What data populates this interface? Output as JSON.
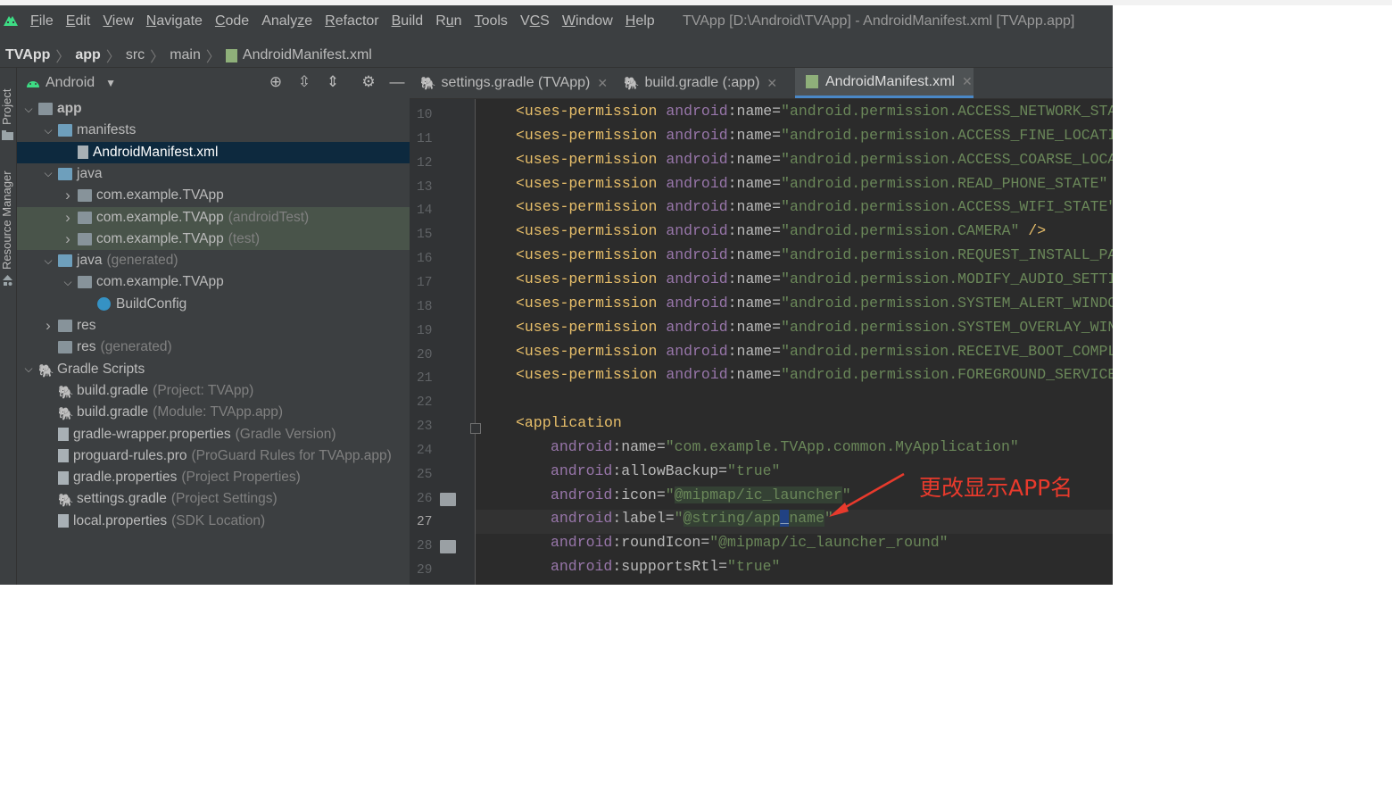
{
  "window": {
    "title": "TVApp [D:\\Android\\TVApp] - AndroidManifest.xml [TVApp.app]",
    "menu": [
      {
        "label": "File",
        "mnemonic_index": 0
      },
      {
        "label": "Edit",
        "mnemonic_index": 0
      },
      {
        "label": "View",
        "mnemonic_index": 0
      },
      {
        "label": "Navigate",
        "mnemonic_index": 0
      },
      {
        "label": "Code",
        "mnemonic_index": 0
      },
      {
        "label": "Analyze",
        "mnemonic_index": 5
      },
      {
        "label": "Refactor",
        "mnemonic_index": 0
      },
      {
        "label": "Build",
        "mnemonic_index": 0
      },
      {
        "label": "Run",
        "mnemonic_index": 1
      },
      {
        "label": "Tools",
        "mnemonic_index": 0
      },
      {
        "label": "VCS",
        "mnemonic_index": 1
      },
      {
        "label": "Window",
        "mnemonic_index": 0
      },
      {
        "label": "Help",
        "mnemonic_index": 0
      }
    ]
  },
  "breadcrumb": [
    "TVApp",
    "app",
    "src",
    "main",
    "AndroidManifest.xml"
  ],
  "left_strip": {
    "project": "Project",
    "resource_manager": "Resource Manager"
  },
  "project_panel": {
    "view_label": "Android",
    "tree": [
      {
        "label": "app",
        "hint": "",
        "depth": 0,
        "expand": "open",
        "icon": "module-folder",
        "bold": true
      },
      {
        "label": "manifests",
        "hint": "",
        "depth": 1,
        "expand": "open",
        "icon": "folder-blue"
      },
      {
        "label": "AndroidManifest.xml",
        "hint": "",
        "depth": 2,
        "expand": "none",
        "icon": "manifest-file",
        "selected": true
      },
      {
        "label": "java",
        "hint": "",
        "depth": 1,
        "expand": "open",
        "icon": "folder-blue"
      },
      {
        "label": "com.example.TVApp",
        "hint": "",
        "depth": 2,
        "expand": "closed",
        "icon": "package"
      },
      {
        "label": "com.example.TVApp",
        "hint": "(androidTest)",
        "depth": 2,
        "expand": "closed",
        "icon": "package",
        "test": true
      },
      {
        "label": "com.example.TVApp",
        "hint": "(test)",
        "depth": 2,
        "expand": "closed",
        "icon": "package",
        "test": true
      },
      {
        "label": "java",
        "hint": "(generated)",
        "depth": 1,
        "expand": "open",
        "icon": "folder-generated"
      },
      {
        "label": "com.example.TVApp",
        "hint": "",
        "depth": 2,
        "expand": "open",
        "icon": "package"
      },
      {
        "label": "BuildConfig",
        "hint": "",
        "depth": 3,
        "expand": "none",
        "icon": "class"
      },
      {
        "label": "res",
        "hint": "",
        "depth": 1,
        "expand": "closed",
        "icon": "folder-res"
      },
      {
        "label": "res",
        "hint": "(generated)",
        "depth": 1,
        "expand": "none",
        "icon": "folder-res"
      },
      {
        "label": "Gradle Scripts",
        "hint": "",
        "depth": 0,
        "expand": "open",
        "icon": "gradle"
      },
      {
        "label": "build.gradle",
        "hint": "(Project: TVApp)",
        "depth": 1,
        "expand": "none",
        "icon": "gradle"
      },
      {
        "label": "build.gradle",
        "hint": "(Module: TVApp.app)",
        "depth": 1,
        "expand": "none",
        "icon": "gradle"
      },
      {
        "label": "gradle-wrapper.properties",
        "hint": "(Gradle Version)",
        "depth": 1,
        "expand": "none",
        "icon": "properties"
      },
      {
        "label": "proguard-rules.pro",
        "hint": "(ProGuard Rules for TVApp.app)",
        "depth": 1,
        "expand": "none",
        "icon": "text-file"
      },
      {
        "label": "gradle.properties",
        "hint": "(Project Properties)",
        "depth": 1,
        "expand": "none",
        "icon": "properties"
      },
      {
        "label": "settings.gradle",
        "hint": "(Project Settings)",
        "depth": 1,
        "expand": "none",
        "icon": "gradle"
      },
      {
        "label": "local.properties",
        "hint": "(SDK Location)",
        "depth": 1,
        "expand": "none",
        "icon": "properties"
      }
    ]
  },
  "tabs": [
    {
      "label": "settings.gradle (TVApp)",
      "icon": "gradle-icon",
      "active": false
    },
    {
      "label": "build.gradle (:app)",
      "icon": "gradle-icon",
      "active": false
    },
    {
      "label": "AndroidManifest.xml",
      "icon": "manifest-icon",
      "active": true
    }
  ],
  "editor": {
    "current_line": 27,
    "lines": [
      {
        "no": 10,
        "indent": 1,
        "tokens": [
          [
            "t",
            "<uses-permission "
          ],
          [
            "a",
            "android"
          ],
          [
            "n",
            ":name="
          ],
          [
            "v",
            "\"android.permission.ACCESS_NETWORK_STATE\""
          ]
        ]
      },
      {
        "no": 11,
        "indent": 1,
        "tokens": [
          [
            "t",
            "<uses-permission "
          ],
          [
            "a",
            "android"
          ],
          [
            "n",
            ":name="
          ],
          [
            "v",
            "\"android.permission.ACCESS_FINE_LOCATION\""
          ]
        ]
      },
      {
        "no": 12,
        "indent": 1,
        "tokens": [
          [
            "t",
            "<uses-permission "
          ],
          [
            "a",
            "android"
          ],
          [
            "n",
            ":name="
          ],
          [
            "v",
            "\"android.permission.ACCESS_COARSE_LOCATION\""
          ]
        ]
      },
      {
        "no": 13,
        "indent": 1,
        "tokens": [
          [
            "t",
            "<uses-permission "
          ],
          [
            "a",
            "android"
          ],
          [
            "n",
            ":name="
          ],
          [
            "v",
            "\"android.permission.READ_PHONE_STATE\""
          ],
          [
            "t",
            " />"
          ]
        ]
      },
      {
        "no": 14,
        "indent": 1,
        "tokens": [
          [
            "t",
            "<uses-permission "
          ],
          [
            "a",
            "android"
          ],
          [
            "n",
            ":name="
          ],
          [
            "v",
            "\"android.permission.ACCESS_WIFI_STATE\""
          ],
          [
            "t",
            " />"
          ]
        ]
      },
      {
        "no": 15,
        "indent": 1,
        "tokens": [
          [
            "t",
            "<uses-permission "
          ],
          [
            "a",
            "android"
          ],
          [
            "n",
            ":name="
          ],
          [
            "v",
            "\"android.permission.CAMERA\""
          ],
          [
            "t",
            " />"
          ]
        ]
      },
      {
        "no": 16,
        "indent": 1,
        "tokens": [
          [
            "t",
            "<uses-permission "
          ],
          [
            "a",
            "android"
          ],
          [
            "n",
            ":name="
          ],
          [
            "v",
            "\"android.permission.REQUEST_INSTALL_PACKAGES\""
          ]
        ]
      },
      {
        "no": 17,
        "indent": 1,
        "tokens": [
          [
            "t",
            "<uses-permission "
          ],
          [
            "a",
            "android"
          ],
          [
            "n",
            ":name="
          ],
          [
            "v",
            "\"android.permission.MODIFY_AUDIO_SETTINGS\""
          ]
        ]
      },
      {
        "no": 18,
        "indent": 1,
        "tokens": [
          [
            "t",
            "<uses-permission "
          ],
          [
            "a",
            "android"
          ],
          [
            "n",
            ":name="
          ],
          [
            "v",
            "\"android.permission.SYSTEM_ALERT_WINDOW\""
          ]
        ]
      },
      {
        "no": 19,
        "indent": 1,
        "tokens": [
          [
            "t",
            "<uses-permission "
          ],
          [
            "a",
            "android"
          ],
          [
            "n",
            ":name="
          ],
          [
            "v",
            "\"android.permission.SYSTEM_OVERLAY_WINDOW\""
          ]
        ]
      },
      {
        "no": 20,
        "indent": 1,
        "tokens": [
          [
            "t",
            "<uses-permission "
          ],
          [
            "a",
            "android"
          ],
          [
            "n",
            ":name="
          ],
          [
            "v",
            "\"android.permission.RECEIVE_BOOT_COMPLETED\""
          ]
        ]
      },
      {
        "no": 21,
        "indent": 1,
        "tokens": [
          [
            "t",
            "<uses-permission "
          ],
          [
            "a",
            "android"
          ],
          [
            "n",
            ":name="
          ],
          [
            "v",
            "\"android.permission.FOREGROUND_SERVICE\""
          ]
        ]
      },
      {
        "no": 22,
        "indent": 0,
        "tokens": []
      },
      {
        "no": 23,
        "indent": 1,
        "tokens": [
          [
            "t",
            "<application"
          ]
        ],
        "fold": true
      },
      {
        "no": 24,
        "indent": 2,
        "tokens": [
          [
            "a",
            "android"
          ],
          [
            "n",
            ":name="
          ],
          [
            "v",
            "\"com.example.TVApp.common.MyApplication\""
          ]
        ]
      },
      {
        "no": 25,
        "indent": 2,
        "tokens": [
          [
            "a",
            "android"
          ],
          [
            "n",
            ":allowBackup="
          ],
          [
            "v",
            "\"true\""
          ]
        ]
      },
      {
        "no": 26,
        "indent": 2,
        "tokens": [
          [
            "a",
            "android"
          ],
          [
            "n",
            ":icon="
          ],
          [
            "v",
            "\""
          ],
          [
            "hl",
            "@mipmap/ic_launcher"
          ],
          [
            "v",
            "\""
          ]
        ],
        "gutter_image": true
      },
      {
        "no": 27,
        "indent": 2,
        "tokens": [
          [
            "a",
            "android"
          ],
          [
            "n",
            ":label="
          ],
          [
            "v",
            "\""
          ],
          [
            "hl",
            "@string/app"
          ],
          [
            "caret",
            "_"
          ],
          [
            "hl",
            "name"
          ],
          [
            "v",
            "\""
          ]
        ]
      },
      {
        "no": 28,
        "indent": 2,
        "tokens": [
          [
            "a",
            "android"
          ],
          [
            "n",
            ":roundIcon="
          ],
          [
            "v",
            "\"@mipmap/ic_launcher_round\""
          ]
        ],
        "gutter_image": true
      },
      {
        "no": 29,
        "indent": 2,
        "tokens": [
          [
            "a",
            "android"
          ],
          [
            "n",
            ":supportsRtl="
          ],
          [
            "v",
            "\"true\""
          ]
        ]
      }
    ]
  },
  "annotation": {
    "text": "更改显示APP名",
    "color": "#e83a2c"
  },
  "colors": {
    "tag": "#e8bf6a",
    "attr_ns": "#9876aa",
    "value": "#6a8759",
    "accent": "#4a88c7",
    "selection": "#0d293e"
  }
}
